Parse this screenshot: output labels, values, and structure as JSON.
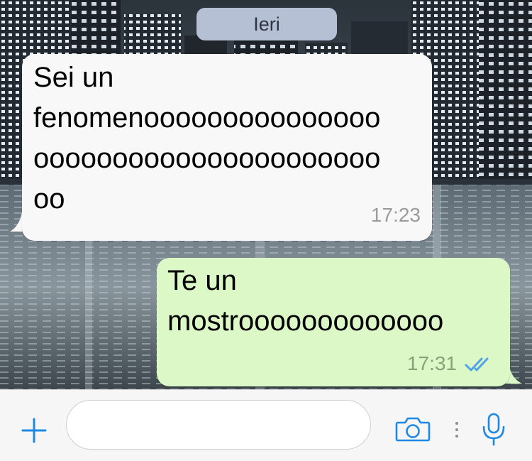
{
  "chat": {
    "date_separator": "Ieri",
    "messages": [
      {
        "direction": "incoming",
        "lines": [
          "Sei un",
          "fenomenooooooooooooooo",
          "oooooooooooooooooooooo",
          "oo"
        ],
        "time": "17:23"
      },
      {
        "direction": "outgoing",
        "lines": [
          "Te un",
          "mostrooooooooooooo"
        ],
        "time": "17:31",
        "status": "read"
      }
    ]
  },
  "composer": {
    "attach_icon": "plus-icon",
    "message_value": "",
    "camera_icon": "camera-icon",
    "mic_icon": "microphone-icon"
  },
  "colors": {
    "incoming_bubble": "#f8f8f8",
    "outgoing_bubble": "#dcf8c6",
    "accent": "#1e88e5",
    "read_ticks": "#4fa3e9",
    "date_pill": "#b6c0d4"
  }
}
